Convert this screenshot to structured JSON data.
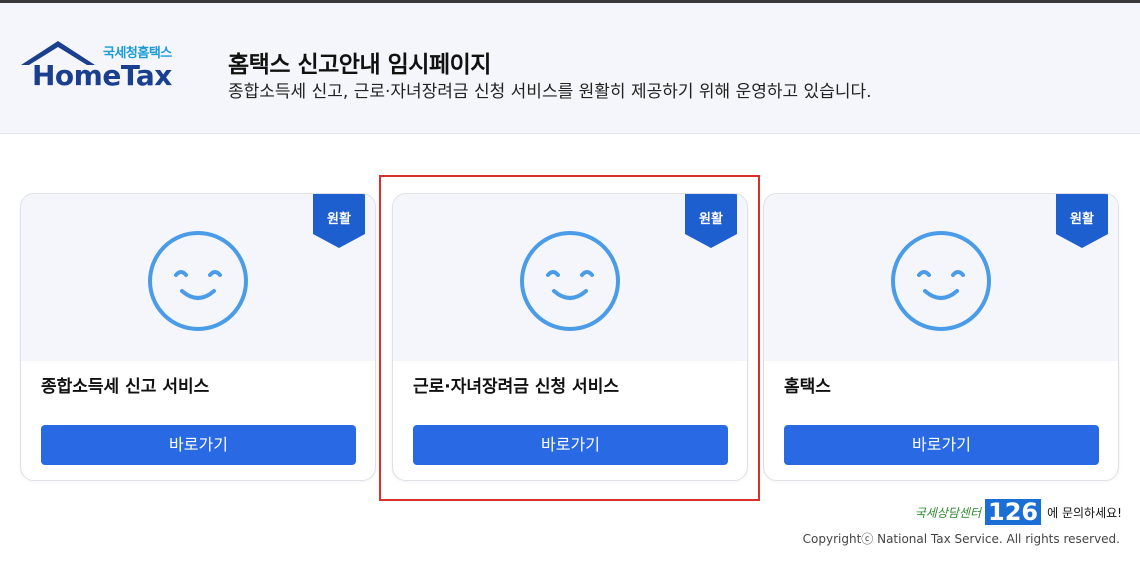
{
  "header": {
    "logo_korean": "국세청홈택스",
    "logo_english": "HomeTax",
    "title": "홈택스 신고안내 임시페이지",
    "subtitle": "종합소득세 신고, 근로·자녀장려금 신청 서비스를 원활히 제공하기 위해 운영하고 있습니다."
  },
  "cards": [
    {
      "status": "원활",
      "title": "종합소득세 신고 서비스",
      "button": "바로가기"
    },
    {
      "status": "원활",
      "title": "근로·자녀장려금 신청 서비스",
      "button": "바로가기"
    },
    {
      "status": "원활",
      "title": "홈택스",
      "button": "바로가기"
    }
  ],
  "footer": {
    "contact_label": "국세상담센터",
    "contact_number": "126",
    "contact_suffix": "에 문의하세요!",
    "copyright": "Copyrightⓒ National Tax Service. All rights reserved."
  },
  "colors": {
    "brand_blue": "#1b3f8f",
    "button_blue": "#2969e4",
    "badge_blue": "#1e5fd0",
    "smiley_blue": "#4a9be8",
    "highlight_red": "#d9302c"
  },
  "icons": {
    "card_status": "smiley-face-icon",
    "logo": "house-roof-icon"
  }
}
